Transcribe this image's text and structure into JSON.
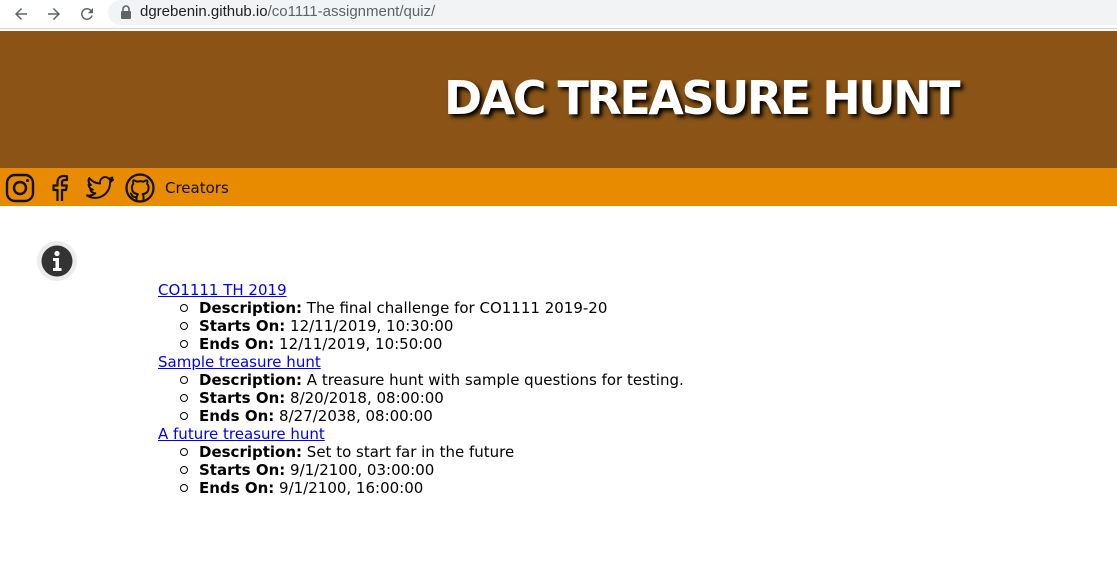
{
  "browser": {
    "url_host": "dgrebenin.github.io",
    "url_path": "/co1111-assignment/quiz/",
    "back_icon": "back-arrow-icon",
    "forward_icon": "forward-arrow-icon",
    "reload_icon": "reload-icon"
  },
  "header": {
    "title": "DAC TREASURE HUNT",
    "background": "#8b5416"
  },
  "nav": {
    "background": "#e88b00",
    "icons": [
      "instagram-icon",
      "facebook-icon",
      "twitter-icon",
      "github-icon"
    ],
    "creators_label": "Creators"
  },
  "info_icon": "info-icon",
  "labels": {
    "description": "Description:",
    "starts_on": "Starts On:",
    "ends_on": "Ends On:"
  },
  "hunts": [
    {
      "name": "CO1111 TH 2019",
      "description": "The final challenge for CO1111 2019-20",
      "starts_on": "12/11/2019, 10:30:00",
      "ends_on": "12/11/2019, 10:50:00"
    },
    {
      "name": "Sample treasure hunt",
      "description": "A treasure hunt with sample questions for testing.",
      "starts_on": "8/20/2018, 08:00:00",
      "ends_on": "8/27/2038, 08:00:00"
    },
    {
      "name": "A future treasure hunt",
      "description": "Set to start far in the future",
      "starts_on": "9/1/2100, 03:00:00",
      "ends_on": "9/1/2100, 16:00:00"
    }
  ]
}
